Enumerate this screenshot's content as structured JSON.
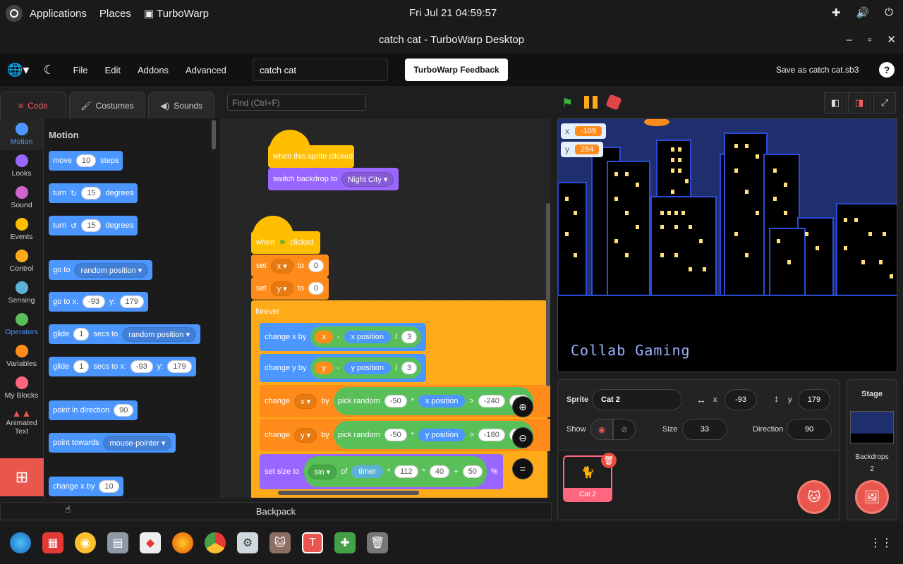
{
  "system": {
    "applications": "Applications",
    "places": "Places",
    "active_app": "TurboWarp",
    "clock": "Fri Jul 21  04:59:57"
  },
  "window": {
    "title": "catch cat - TurboWarp Desktop"
  },
  "menu": {
    "file": "File",
    "edit": "Edit",
    "addons": "Addons",
    "advanced": "Advanced",
    "project_title": "catch cat",
    "feedback": "TurboWarp Feedback",
    "save_as": "Save as catch cat.sb3",
    "help": "?"
  },
  "tabs": {
    "code": "Code",
    "costumes": "Costumes",
    "sounds": "Sounds"
  },
  "find_placeholder": "Find (Ctrl+F)",
  "categories": [
    {
      "label": "Motion",
      "color": "#4c97ff"
    },
    {
      "label": "Looks",
      "color": "#9966ff"
    },
    {
      "label": "Sound",
      "color": "#cf63cf"
    },
    {
      "label": "Events",
      "color": "#ffbf00"
    },
    {
      "label": "Control",
      "color": "#ffab19"
    },
    {
      "label": "Sensing",
      "color": "#5cb1d6"
    },
    {
      "label": "Operators",
      "color": "#59c059"
    },
    {
      "label": "Variables",
      "color": "#ff8c1a"
    },
    {
      "label": "My Blocks",
      "color": "#ff6680"
    },
    {
      "label": "Animated Text",
      "color": "#e9564e"
    }
  ],
  "palette": {
    "heading": "Motion",
    "move": {
      "a": "move",
      "n": "10",
      "b": "steps"
    },
    "turn_right": {
      "a": "turn",
      "n": "15",
      "b": "degrees"
    },
    "turn_left": {
      "a": "turn",
      "n": "15",
      "b": "degrees"
    },
    "goto": {
      "a": "go to",
      "opt": "random position"
    },
    "gotoxy": {
      "a": "go to x:",
      "x": "-93",
      "b": "y:",
      "y": "179"
    },
    "glide_to": {
      "a": "glide",
      "n": "1",
      "b": "secs to",
      "opt": "random position"
    },
    "glide_xy": {
      "a": "glide",
      "n": "1",
      "b": "secs to x:",
      "x": "-93",
      "c": "y:",
      "y": "179"
    },
    "point_dir": {
      "a": "point in direction",
      "n": "90"
    },
    "point_towards": {
      "a": "point towards",
      "opt": "mouse-pointer"
    },
    "change_x": {
      "a": "change x by",
      "n": "10"
    }
  },
  "script": {
    "hat1": "when this sprite clicked",
    "switch_backdrop": {
      "a": "switch backdrop to",
      "opt": "Night City"
    },
    "hat2": {
      "a": "when",
      "b": "clicked"
    },
    "set_x": {
      "a": "set",
      "var": "x",
      "b": "to",
      "v": "0"
    },
    "set_y": {
      "a": "set",
      "var": "y",
      "b": "to",
      "v": "0"
    },
    "forever": "forever",
    "change_x_by": {
      "a": "change x by",
      "var": "x",
      "minus": "-",
      "rep": "x position",
      "div": "/",
      "n": "3"
    },
    "change_y_by": {
      "a": "change y by",
      "var": "y",
      "minus": "-",
      "rep": "y position",
      "div": "/",
      "n": "3"
    },
    "change_var_x": {
      "a": "change",
      "var": "x",
      "b": "by",
      "pr": "pick random",
      "lo": "-50",
      "mul": "*",
      "rep": "x position",
      "gt": ">",
      "v": "-240",
      "hi": "50"
    },
    "change_var_y": {
      "a": "change",
      "var": "y",
      "b": "by",
      "pr": "pick random",
      "lo": "-50",
      "mul": "*",
      "rep": "y position",
      "gt": ">",
      "v": "-180",
      "hi": "50"
    },
    "set_size": {
      "a": "set size to",
      "fn": "sin",
      "of": "of",
      "timer": "timer",
      "m1": "*",
      "n1": "112",
      "m2": "*",
      "n2": "40",
      "plus": "+",
      "n3": "50",
      "pct": "%"
    }
  },
  "backpack": "Backpack",
  "stage": {
    "monitor_x": {
      "label": "x",
      "value": "-109"
    },
    "monitor_y": {
      "label": "y",
      "value": "254"
    },
    "overlay_text": "Collab Gaming"
  },
  "sprite_info": {
    "sprite_label": "Sprite",
    "sprite_name": "Cat 2",
    "x_label": "x",
    "x": "-93",
    "y_label": "y",
    "y": "179",
    "show_label": "Show",
    "size_label": "Size",
    "size": "33",
    "direction_label": "Direction",
    "direction": "90",
    "card_name": "Cat 2"
  },
  "stage_pane": {
    "title": "Stage",
    "backdrops_label": "Backdrops",
    "backdrops_count": "2"
  }
}
